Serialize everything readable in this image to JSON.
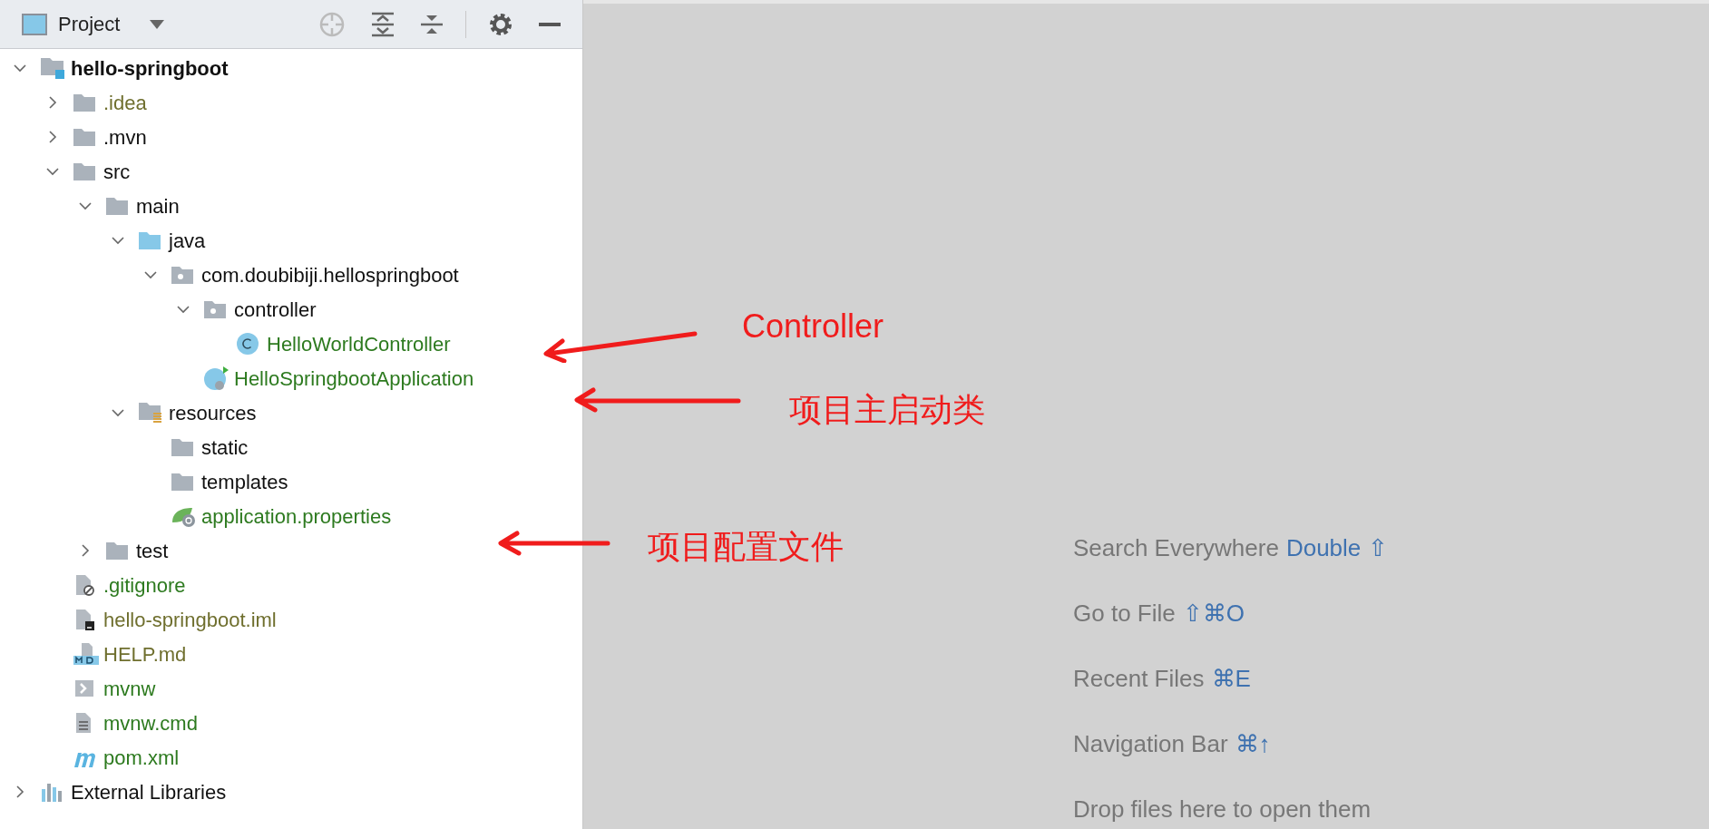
{
  "panel": {
    "title": "Project"
  },
  "tree": [
    {
      "label": "hello-springboot",
      "kind": "module",
      "expanded": true,
      "children": [
        {
          "label": ".idea",
          "kind": "folder",
          "expanded": false,
          "color": "#6f6f2e"
        },
        {
          "label": ".mvn",
          "kind": "folder",
          "expanded": false
        },
        {
          "label": "src",
          "kind": "folder",
          "expanded": true,
          "children": [
            {
              "label": "main",
              "kind": "folder",
              "expanded": true,
              "children": [
                {
                  "label": "java",
                  "kind": "source-folder",
                  "expanded": true,
                  "children": [
                    {
                      "label": "com.doubibiji.hellospringboot",
                      "kind": "package",
                      "expanded": true,
                      "children": [
                        {
                          "label": "controller",
                          "kind": "package",
                          "expanded": true,
                          "children": [
                            {
                              "label": "HelloWorldController",
                              "kind": "class",
                              "color": "#2d7a1f"
                            }
                          ]
                        },
                        {
                          "label": "HelloSpringbootApplication",
                          "kind": "app-class",
                          "color": "#2d7a1f"
                        }
                      ]
                    }
                  ]
                },
                {
                  "label": "resources",
                  "kind": "resources",
                  "expanded": true,
                  "children": [
                    {
                      "label": "static",
                      "kind": "folder"
                    },
                    {
                      "label": "templates",
                      "kind": "folder"
                    },
                    {
                      "label": "application.properties",
                      "kind": "spring",
                      "color": "#2d7a1f"
                    }
                  ]
                }
              ]
            },
            {
              "label": "test",
              "kind": "folder",
              "expanded": false
            }
          ]
        },
        {
          "label": ".gitignore",
          "kind": "ignore-file",
          "color": "#2d7a1f"
        },
        {
          "label": "hello-springboot.iml",
          "kind": "iml",
          "color": "#6f6f2e"
        },
        {
          "label": "HELP.md",
          "kind": "markdown",
          "color": "#6f6f2e"
        },
        {
          "label": "mvnw",
          "kind": "script",
          "color": "#2d7a1f"
        },
        {
          "label": "mvnw.cmd",
          "kind": "text-file",
          "color": "#2d7a1f"
        },
        {
          "label": "pom.xml",
          "kind": "maven",
          "color": "#2d7a1f"
        }
      ]
    },
    {
      "label": "External Libraries",
      "kind": "libraries",
      "expanded": false
    }
  ],
  "editor_hints": [
    {
      "text": "Search Everywhere",
      "shortcut": "Double ⇧"
    },
    {
      "text": "Go to File",
      "shortcut": "⇧⌘O"
    },
    {
      "text": "Recent Files",
      "shortcut": "⌘E"
    },
    {
      "text": "Navigation Bar",
      "shortcut": "⌘↑"
    },
    {
      "text": "Drop files here to open them"
    }
  ],
  "annotations": [
    "Controller",
    "项目主启动类",
    "项目配置文件"
  ]
}
